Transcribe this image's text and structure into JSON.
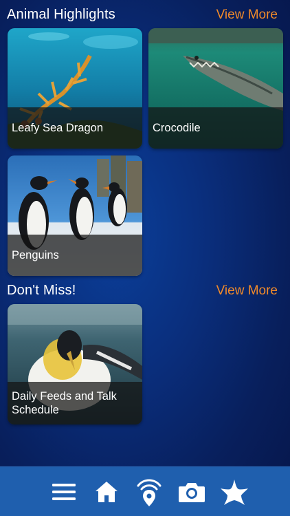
{
  "sections": [
    {
      "title": "Animal Highlights",
      "view_more": "View More",
      "cards": [
        {
          "label": "Leafy Sea Dragon"
        },
        {
          "label": "Crocodile"
        },
        {
          "label": "Penguins"
        }
      ]
    },
    {
      "title": "Don't Miss!",
      "view_more": "View More",
      "cards": [
        {
          "label": "Daily Feeds and Talk Schedule"
        }
      ]
    }
  ],
  "tabbar": {
    "items": [
      {
        "icon": "menu-icon"
      },
      {
        "icon": "home-icon"
      },
      {
        "icon": "location-beacon-icon"
      },
      {
        "icon": "camera-icon"
      },
      {
        "icon": "starfish-icon"
      }
    ]
  },
  "colors": {
    "accent": "#f08a2a",
    "tabbar": "#1f5fae",
    "background": "#0a2f7e"
  }
}
